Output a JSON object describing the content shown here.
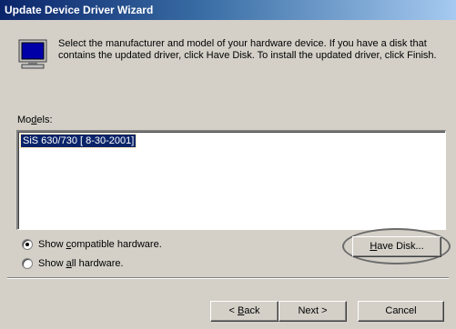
{
  "window": {
    "title": "Update Device Driver Wizard"
  },
  "header": {
    "icon": "monitor-icon",
    "instructions": "Select the manufacturer and model of your hardware device. If you have a disk that contains the updated driver, click Have Disk. To install the updated driver, click Finish."
  },
  "models": {
    "label_prefix": "Mo",
    "label_accel": "d",
    "label_suffix": "els:",
    "items": [
      "SiS 630/730 [ 8-30-2001]"
    ],
    "selected_index": 0
  },
  "options": {
    "compatible": {
      "prefix": "Show ",
      "accel": "c",
      "suffix": "ompatible hardware.",
      "checked": true
    },
    "all": {
      "prefix": "Show ",
      "accel": "a",
      "suffix": "ll hardware.",
      "checked": false
    }
  },
  "buttons": {
    "have_disk": {
      "accel": "H",
      "rest": "ave Disk..."
    },
    "back": {
      "prefix": "< ",
      "accel": "B",
      "rest": "ack"
    },
    "next": {
      "label": "Next >"
    },
    "cancel": {
      "label": "Cancel"
    }
  },
  "colors": {
    "selection": "#0a246a",
    "dialog_face": "#d4d0c8",
    "title_gradient_start": "#0a246a"
  }
}
